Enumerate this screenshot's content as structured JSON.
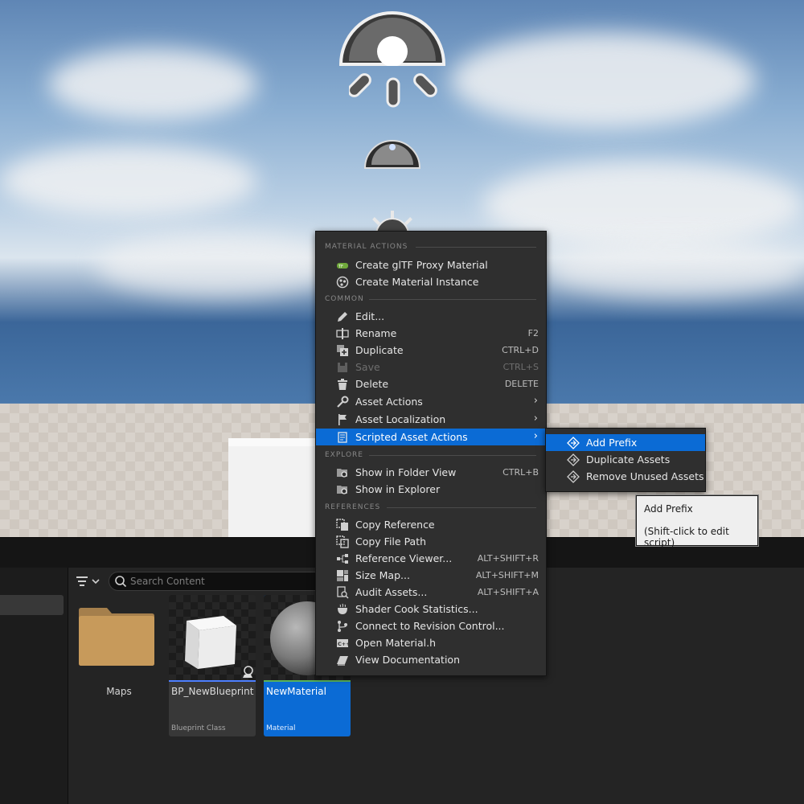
{
  "context_menu": {
    "sections": {
      "material_actions": "MATERIAL ACTIONS",
      "common": "COMMON",
      "explore": "EXPLORE",
      "references": "REFERENCES"
    },
    "items": {
      "create_gltf_proxy": {
        "label": "Create glTF Proxy Material",
        "icon": "gltf-icon"
      },
      "create_material_instance": {
        "label": "Create Material Instance",
        "icon": "material-instance-icon"
      },
      "edit": {
        "label": "Edit...",
        "icon": "pencil-icon"
      },
      "rename": {
        "label": "Rename",
        "shortcut": "F2",
        "icon": "rename-icon"
      },
      "duplicate": {
        "label": "Duplicate",
        "shortcut": "CTRL+D",
        "icon": "duplicate-icon"
      },
      "save": {
        "label": "Save",
        "shortcut": "CTRL+S",
        "icon": "save-icon",
        "enabled": false
      },
      "delete": {
        "label": "Delete",
        "shortcut": "DELETE",
        "icon": "trash-icon"
      },
      "asset_actions": {
        "label": "Asset Actions",
        "icon": "wrench-icon"
      },
      "asset_localization": {
        "label": "Asset Localization",
        "icon": "flag-icon"
      },
      "scripted_asset_actions": {
        "label": "Scripted Asset Actions",
        "icon": "script-icon",
        "highlighted": true
      },
      "show_in_folder_view": {
        "label": "Show in Folder View",
        "shortcut": "CTRL+B",
        "icon": "folder-search-icon"
      },
      "show_in_explorer": {
        "label": "Show in Explorer",
        "icon": "folder-search-icon"
      },
      "copy_reference": {
        "label": "Copy Reference",
        "icon": "copy-icon"
      },
      "copy_file_path": {
        "label": "Copy File Path",
        "icon": "copy-icon"
      },
      "reference_viewer": {
        "label": "Reference Viewer...",
        "shortcut": "ALT+SHIFT+R",
        "icon": "reference-viewer-icon"
      },
      "size_map": {
        "label": "Size Map...",
        "shortcut": "ALT+SHIFT+M",
        "icon": "size-map-icon"
      },
      "audit_assets": {
        "label": "Audit Assets...",
        "shortcut": "ALT+SHIFT+A",
        "icon": "audit-icon"
      },
      "shader_cook_statistics": {
        "label": "Shader Cook Statistics...",
        "icon": "shader-icon"
      },
      "connect_revision_control": {
        "label": "Connect to Revision Control...",
        "icon": "revision-control-icon"
      },
      "open_material_h": {
        "label": "Open Material.h",
        "icon": "cpp-icon"
      },
      "view_documentation": {
        "label": "View Documentation",
        "icon": "book-icon"
      }
    }
  },
  "submenu": {
    "items": [
      {
        "label": "Add Prefix",
        "icon": "script-action-icon",
        "highlighted": true
      },
      {
        "label": "Duplicate Assets",
        "icon": "script-action-icon"
      },
      {
        "label": "Remove Unused Assets",
        "icon": "script-action-icon"
      }
    ]
  },
  "tooltip": {
    "title": "Add Prefix",
    "hint": "(Shift-click to edit script)"
  },
  "content_browser": {
    "search_placeholder": "Search Content",
    "assets": [
      {
        "name": "Maps",
        "kind": "folder"
      },
      {
        "name": "BP_NewBlueprint",
        "type": "Blueprint Class"
      },
      {
        "name": "NewMaterial",
        "type": "Material",
        "selected": true
      }
    ]
  },
  "colors": {
    "accent": "#0b6bd5",
    "menu_bg": "#2f2f2f",
    "blueprint_underline": "#4d7fff",
    "material_underline": "#58b35a"
  }
}
